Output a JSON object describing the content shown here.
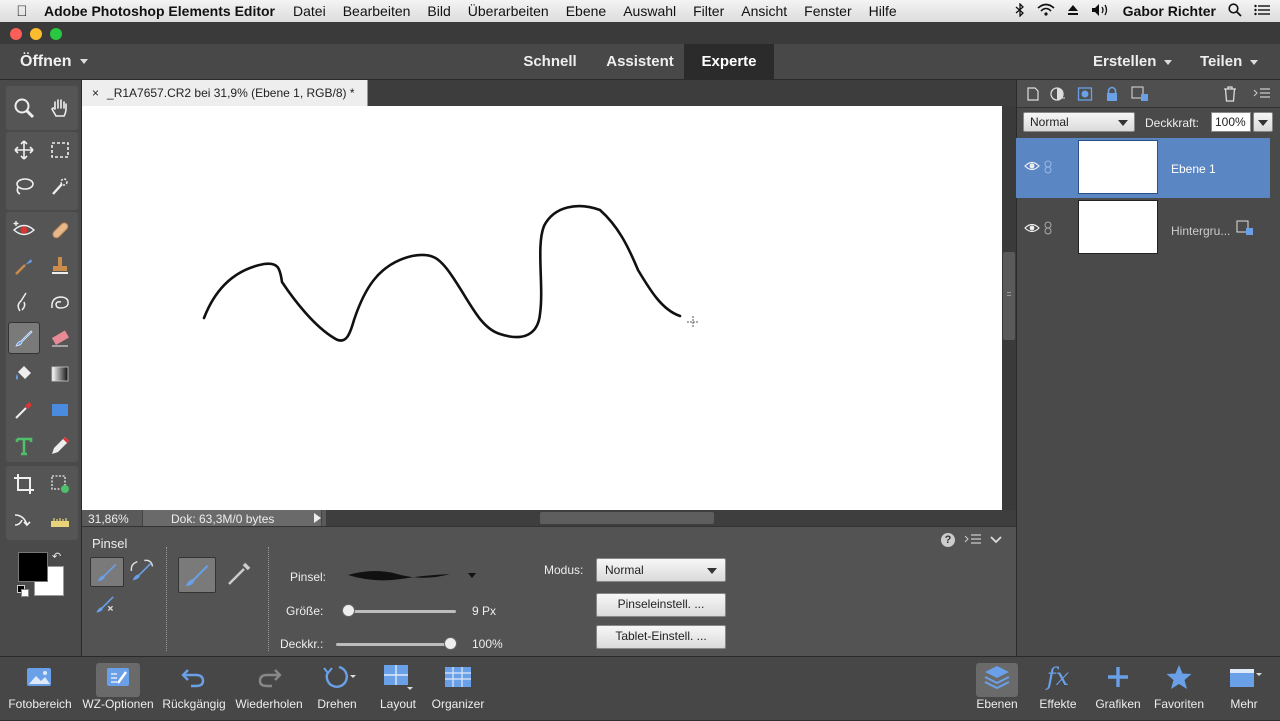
{
  "menubar": {
    "app_name": "Adobe Photoshop Elements Editor",
    "items": [
      "Datei",
      "Bearbeiten",
      "Bild",
      "Überarbeiten",
      "Ebene",
      "Auswahl",
      "Filter",
      "Ansicht",
      "Fenster",
      "Hilfe"
    ],
    "user": "Gabor Richter"
  },
  "header": {
    "open_label": "Öffnen",
    "modes": [
      "Schnell",
      "Assistent",
      "Experte"
    ],
    "active_mode": "Experte",
    "create_label": "Erstellen",
    "share_label": "Teilen"
  },
  "document": {
    "tab_title": "_R1A7657.CR2 bei 31,9% (Ebene 1, RGB/8) *",
    "close_glyph": "×",
    "zoom": "31,86%",
    "doc_info": "Dok: 63,3M/0 bytes"
  },
  "tool_options": {
    "title": "Pinsel",
    "brush_label": "Pinsel:",
    "size_label": "Größe:",
    "size_value": "9 Px",
    "size_fraction": 0.0,
    "opacity_label": "Deckkr.:",
    "opacity_value": "100%",
    "opacity_fraction": 1.0,
    "mode_label": "Modus:",
    "mode_value": "Normal",
    "brush_settings_button": "Pinseleinstell. ...",
    "tablet_settings_button": "Tablet-Einstell. ..."
  },
  "layers": {
    "blend_mode": "Normal",
    "opacity_label": "Deckkraft:",
    "opacity_value": "100%",
    "items": [
      {
        "name": "Ebene 1",
        "selected": true
      },
      {
        "name": "Hintergru...",
        "selected": false
      }
    ]
  },
  "bottombar": {
    "left": [
      "Fotobereich",
      "WZ-Optionen",
      "Rückgängig",
      "Wiederholen",
      "Drehen",
      "Layout",
      "Organizer"
    ],
    "right": [
      "Ebenen",
      "Effekte",
      "Grafiken",
      "Favoriten",
      "Mehr"
    ]
  },
  "colors": {
    "accent_selection": "#5b86c4",
    "foreground": "#000000",
    "background": "#ffffff"
  }
}
